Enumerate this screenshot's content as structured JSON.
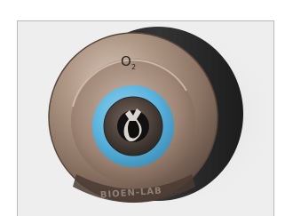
{
  "outlet": {
    "gas_label": "O",
    "gas_subscript": "2",
    "brand_text": "BIOEN-LAB"
  },
  "colors": {
    "panel_background": "#eeeeee",
    "bronze": "#9a8272",
    "ring_blue": "#5ab4de",
    "inner_dark": "#3a3430",
    "housing_dark": "#2f2f30"
  }
}
